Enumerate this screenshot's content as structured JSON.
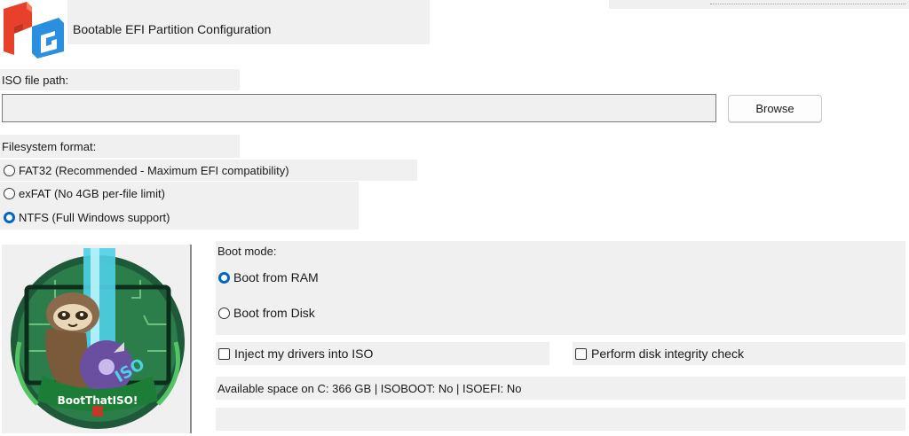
{
  "header": {
    "logo_icon": "fg-logo-icon",
    "title": "Bootable EFI Partition Configuration"
  },
  "iso": {
    "label": "ISO file path:",
    "value": "",
    "browse_label": "Browse"
  },
  "filesystem": {
    "label": "Filesystem format:",
    "options": [
      {
        "label": "FAT32 (Recommended - Maximum EFI compatibility)",
        "selected": false
      },
      {
        "label": "exFAT (No 4GB per-file limit)",
        "selected": false
      },
      {
        "label": "NTFS (Full Windows support)",
        "selected": true
      }
    ]
  },
  "boot_mode": {
    "label": "Boot mode:",
    "options": [
      {
        "label": "Boot from RAM",
        "selected": true
      },
      {
        "label": "Boot from Disk",
        "selected": false
      }
    ]
  },
  "options": {
    "inject_drivers_label": "Inject my drivers into ISO",
    "inject_drivers_checked": false,
    "integrity_label": "Perform disk integrity check",
    "integrity_checked": false
  },
  "status": {
    "space_text": "Available space on C: 366 GB | ISOBOOT: No | ISOEFI: No"
  },
  "mascot": {
    "badge_text": "BootThatISO!",
    "icon": "sloth-mascot-icon"
  },
  "colors": {
    "accent": "#0067c0",
    "panel_bg": "#f0f0f0",
    "logo_red": "#e8412b",
    "logo_blue": "#2b8fe0"
  }
}
